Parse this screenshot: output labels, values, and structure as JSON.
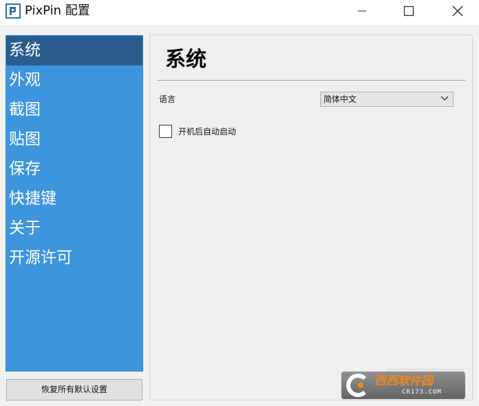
{
  "window": {
    "title": "PixPin 配置",
    "controls": {
      "minimize": "minimize-icon",
      "maximize": "maximize-icon",
      "close": "close-icon"
    }
  },
  "sidebar": {
    "items": [
      {
        "label": "系统",
        "selected": true
      },
      {
        "label": "外观",
        "selected": false
      },
      {
        "label": "截图",
        "selected": false
      },
      {
        "label": "贴图",
        "selected": false
      },
      {
        "label": "保存",
        "selected": false
      },
      {
        "label": "快捷键",
        "selected": false
      },
      {
        "label": "关于",
        "selected": false
      },
      {
        "label": "开源许可",
        "selected": false
      }
    ],
    "background": "#3d95dd",
    "selected_background": "#2b5c8f"
  },
  "reset_button": {
    "label": "恢复所有默认设置"
  },
  "panel": {
    "title": "系统",
    "language": {
      "label": "语言",
      "value": "简体中文"
    },
    "autostart": {
      "label": "开机后自动启动",
      "checked": false
    }
  },
  "watermark": {
    "text": "西西软件园",
    "sub": "CR173.COM"
  }
}
